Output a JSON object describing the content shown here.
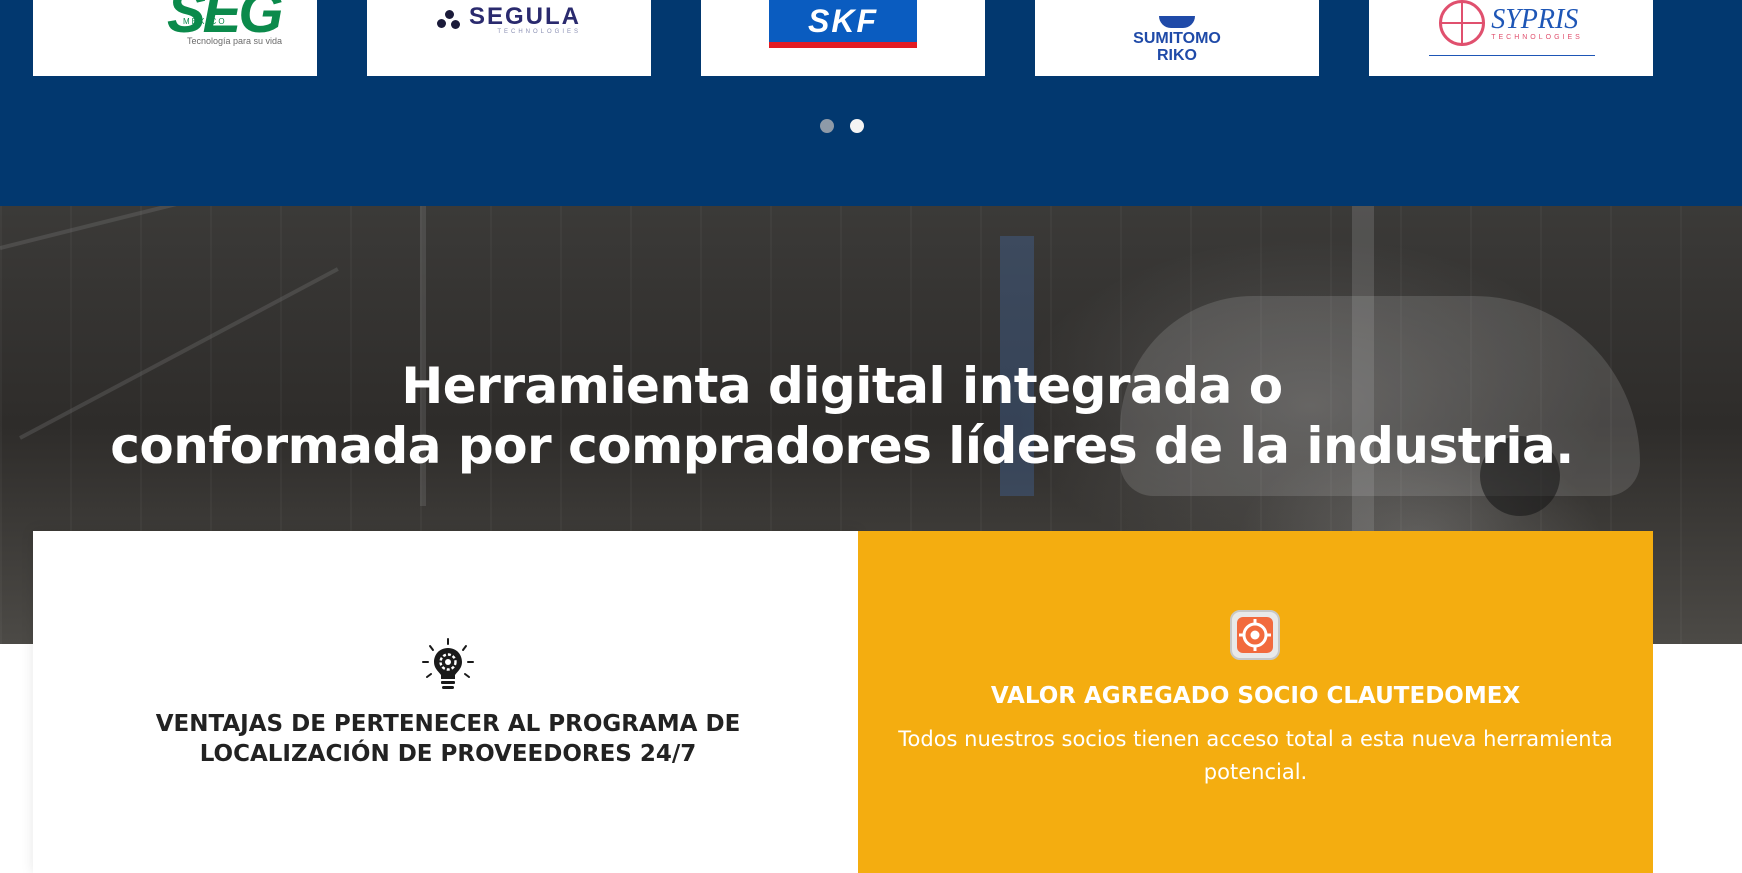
{
  "partners": {
    "seg": {
      "name": "SEG",
      "country": "MEXICO",
      "tagline": "Tecnología para su vida",
      "color": "#0b8a4b"
    },
    "segula": {
      "name": "SEGULA",
      "sub": "TECHNOLOGIES",
      "color": "#2a2a6e"
    },
    "skf": {
      "name": "SKF",
      "color": "#0a5cc0",
      "accent": "#e31b23"
    },
    "sumitomo": {
      "line1": "SUMITOMO",
      "line2": "RIKO",
      "color": "#1f4aa8"
    },
    "sypris": {
      "name": "SYPRIS",
      "sub": "TECHNOLOGIES",
      "color": "#1e56b6",
      "accent": "#e0506e"
    }
  },
  "carousel": {
    "active_page": 2,
    "page_count": 2
  },
  "hero": {
    "title_line1": "Herramienta digital integrada o",
    "title_line2": "conformada por compradores líderes de la industria."
  },
  "benefits": {
    "title_line1": "VENTAJAS DE PERTENECER AL PROGRAMA DE",
    "title_line2": "LOCALIZACIÓN DE PROVEEDORES 24/7",
    "icon": "lightbulb-gear-icon"
  },
  "value": {
    "title": "VALOR AGREGADO SOCIO CLAUTEDOMEX",
    "text": "Todos nuestros socios tienen acceso total a esta nueva herramienta potencial.",
    "icon": "target-icon",
    "background": "#f4ad10"
  },
  "colors": {
    "band": "#02386f",
    "accent": "#f4ad10"
  }
}
